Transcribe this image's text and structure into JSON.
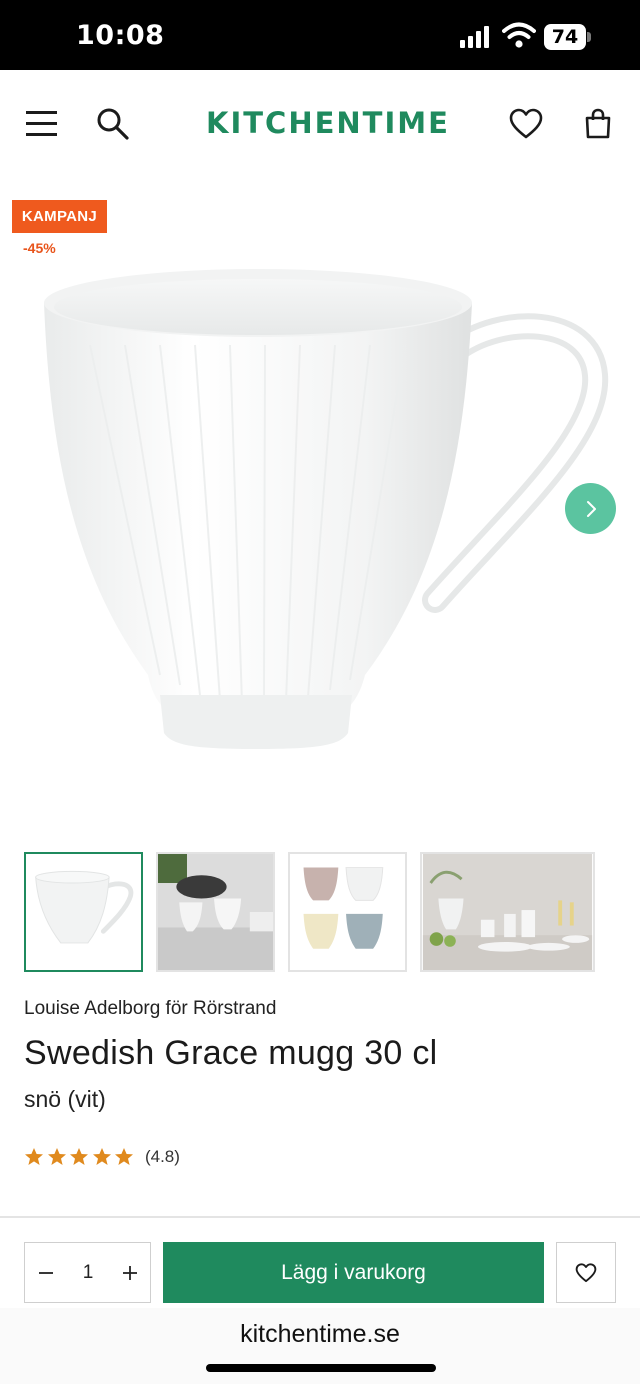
{
  "status_bar": {
    "time": "10:08",
    "battery": "74"
  },
  "header": {
    "logo": "KITCHENTIME",
    "icons": [
      "menu-icon",
      "search-icon",
      "heart-icon",
      "shopping-bag-icon"
    ]
  },
  "product": {
    "badge": "KAMPANJ",
    "discount": "-45%",
    "brand": "Louise Adelborg för Rörstrand",
    "title": "Swedish Grace mugg 30 cl",
    "variant": "snö (vit)",
    "rating": 4.8,
    "rating_text": "(4.8)",
    "stars": 5
  },
  "gallery": {
    "thumbnail_count": 4,
    "active_index": 0
  },
  "purchase": {
    "quantity": "1",
    "add_to_cart": "Lägg i varukorg"
  },
  "browser": {
    "url": "kitchentime.se"
  },
  "colors": {
    "brand_green": "#1f8a5e",
    "campaign_orange": "#ef5a1e",
    "arrow_green": "#5bc4a0",
    "star": "#e08a1e"
  }
}
